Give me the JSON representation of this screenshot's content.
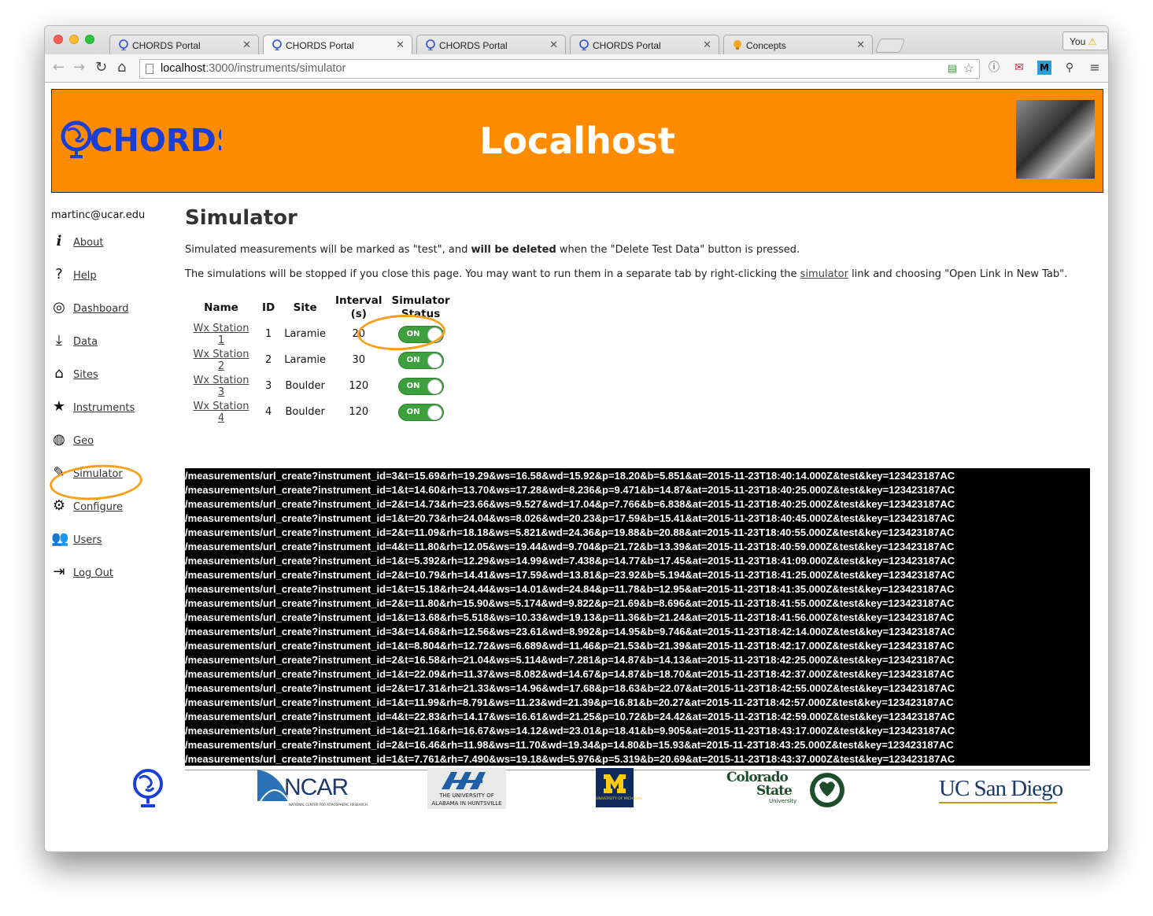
{
  "browser": {
    "tabs": [
      {
        "title": "CHORDS Portal"
      },
      {
        "title": "CHORDS Portal"
      },
      {
        "title": "CHORDS Portal"
      },
      {
        "title": "CHORDS Portal"
      },
      {
        "title": "Concepts"
      }
    ],
    "profile_label": "You",
    "url_host": "localhost",
    "url_path": ":3000/instruments/simulator"
  },
  "banner": {
    "logo_text": "CHORDS",
    "title": "Localhost"
  },
  "sidebar": {
    "user": "martinc@ucar.edu",
    "items": [
      {
        "label": "About",
        "icon": "info-icon"
      },
      {
        "label": "Help",
        "icon": "question-icon"
      },
      {
        "label": "Dashboard",
        "icon": "target-icon"
      },
      {
        "label": "Data",
        "icon": "download-icon"
      },
      {
        "label": "Sites",
        "icon": "home-icon"
      },
      {
        "label": "Instruments",
        "icon": "star-icon"
      },
      {
        "label": "Geo",
        "icon": "globe-icon"
      },
      {
        "label": "Simulator",
        "icon": "pencil-icon"
      },
      {
        "label": "Configure",
        "icon": "gear-icon"
      },
      {
        "label": "Users",
        "icon": "users-icon"
      },
      {
        "label": "Log Out",
        "icon": "logout-icon"
      }
    ]
  },
  "main": {
    "title": "Simulator",
    "para1_a": "Simulated measurements will be marked as \"test\", and ",
    "para1_b": "will be deleted",
    "para1_c": " when the \"Delete Test Data\" button is pressed.",
    "para2_a": "The simulations will be stopped if you close this page. You may want to run them in a separate tab by right-clicking the ",
    "para2_link": "simulator",
    "para2_b": " link and choosing \"Open Link in New Tab\".",
    "table": {
      "headers": {
        "name": "Name",
        "id": "ID",
        "site": "Site",
        "interval_1": "Interval",
        "interval_2": "(s)",
        "status_1": "Simulator",
        "status_2": "Status"
      },
      "rows": [
        {
          "name": "Wx Station 1",
          "id": "1",
          "site": "Laramie",
          "interval": "20",
          "status": "ON"
        },
        {
          "name": "Wx Station 2",
          "id": "2",
          "site": "Laramie",
          "interval": "30",
          "status": "ON"
        },
        {
          "name": "Wx Station 3",
          "id": "3",
          "site": "Boulder",
          "interval": "120",
          "status": "ON"
        },
        {
          "name": "Wx Station 4",
          "id": "4",
          "site": "Boulder",
          "interval": "120",
          "status": "ON"
        }
      ]
    },
    "log": [
      "/measurements/url_create?instrument_id=3&t=15.69&rh=19.29&ws=16.58&wd=15.92&p=18.20&b=5.851&at=2015-11-23T18:40:14.000Z&test&key=123423187AC",
      "/measurements/url_create?instrument_id=1&t=14.60&rh=13.70&ws=17.28&wd=8.236&p=9.471&b=14.87&at=2015-11-23T18:40:25.000Z&test&key=123423187AC",
      "/measurements/url_create?instrument_id=2&t=14.73&rh=23.66&ws=9.527&wd=17.04&p=7.766&b=6.838&at=2015-11-23T18:40:25.000Z&test&key=123423187AC",
      "/measurements/url_create?instrument_id=1&t=20.73&rh=24.04&ws=8.026&wd=20.23&p=17.59&b=15.41&at=2015-11-23T18:40:45.000Z&test&key=123423187AC",
      "/measurements/url_create?instrument_id=2&t=11.09&rh=18.18&ws=5.821&wd=24.36&p=19.88&b=20.88&at=2015-11-23T18:40:55.000Z&test&key=123423187AC",
      "/measurements/url_create?instrument_id=4&t=11.80&rh=12.05&ws=19.44&wd=9.704&p=21.72&b=13.39&at=2015-11-23T18:40:59.000Z&test&key=123423187AC",
      "/measurements/url_create?instrument_id=1&t=5.392&rh=12.29&ws=14.99&wd=7.438&p=14.77&b=17.45&at=2015-11-23T18:41:09.000Z&test&key=123423187AC",
      "/measurements/url_create?instrument_id=2&t=10.79&rh=14.41&ws=17.59&wd=13.81&p=23.92&b=5.194&at=2015-11-23T18:41:25.000Z&test&key=123423187AC",
      "/measurements/url_create?instrument_id=1&t=15.18&rh=24.44&ws=14.01&wd=24.84&p=11.78&b=12.95&at=2015-11-23T18:41:35.000Z&test&key=123423187AC",
      "/measurements/url_create?instrument_id=2&t=11.80&rh=15.90&ws=5.174&wd=9.822&p=21.69&b=8.696&at=2015-11-23T18:41:55.000Z&test&key=123423187AC",
      "/measurements/url_create?instrument_id=1&t=13.68&rh=5.518&ws=10.33&wd=19.13&p=11.36&b=21.24&at=2015-11-23T18:41:56.000Z&test&key=123423187AC",
      "/measurements/url_create?instrument_id=3&t=14.68&rh=12.56&ws=23.61&wd=8.992&p=14.95&b=9.746&at=2015-11-23T18:42:14.000Z&test&key=123423187AC",
      "/measurements/url_create?instrument_id=1&t=8.804&rh=12.72&ws=6.689&wd=11.46&p=21.53&b=21.39&at=2015-11-23T18:42:17.000Z&test&key=123423187AC",
      "/measurements/url_create?instrument_id=2&t=16.58&rh=21.04&ws=5.114&wd=7.281&p=14.87&b=14.13&at=2015-11-23T18:42:25.000Z&test&key=123423187AC",
      "/measurements/url_create?instrument_id=1&t=22.09&rh=11.37&ws=8.082&wd=14.67&p=14.87&b=18.70&at=2015-11-23T18:42:37.000Z&test&key=123423187AC",
      "/measurements/url_create?instrument_id=2&t=17.31&rh=21.33&ws=14.96&wd=17.68&p=18.63&b=22.07&at=2015-11-23T18:42:55.000Z&test&key=123423187AC",
      "/measurements/url_create?instrument_id=1&t=11.99&rh=8.791&ws=11.23&wd=21.39&p=16.81&b=20.27&at=2015-11-23T18:42:57.000Z&test&key=123423187AC",
      "/measurements/url_create?instrument_id=4&t=22.83&rh=14.17&ws=16.61&wd=21.25&p=10.72&b=24.42&at=2015-11-23T18:42:59.000Z&test&key=123423187AC",
      "/measurements/url_create?instrument_id=1&t=21.16&rh=16.67&ws=14.12&wd=23.01&p=18.41&b=9.905&at=2015-11-23T18:43:17.000Z&test&key=123423187AC",
      "/measurements/url_create?instrument_id=2&t=16.46&rh=11.98&ws=11.70&wd=19.34&p=14.80&b=15.93&at=2015-11-23T18:43:25.000Z&test&key=123423187AC",
      "/measurements/url_create?instrument_id=1&t=7.761&rh=7.490&ws=19.18&wd=5.976&p=5.319&b=20.69&at=2015-11-23T18:43:37.000Z&test&key=123423187AC"
    ]
  },
  "footer": {
    "ncar": "NCAR",
    "ncar_sub": "NATIONAL CENTER FOR ATMOSPHERIC RESEARCH",
    "uah_1": "THE UNIVERSITY OF",
    "uah_2": "ALABAMA IN HUNTSVILLE",
    "umich_sub": "UNIVERSITY OF MICHIGAN",
    "csu_1": "Colorado",
    "csu_2": "State",
    "csu_3": "University",
    "ucsd": "UC San Diego"
  },
  "colors": {
    "banner": "#ff8c00",
    "toggle_on": "#3ca03c",
    "annotation": "#f7a01c",
    "chords_blue": "#1a3fd6"
  }
}
